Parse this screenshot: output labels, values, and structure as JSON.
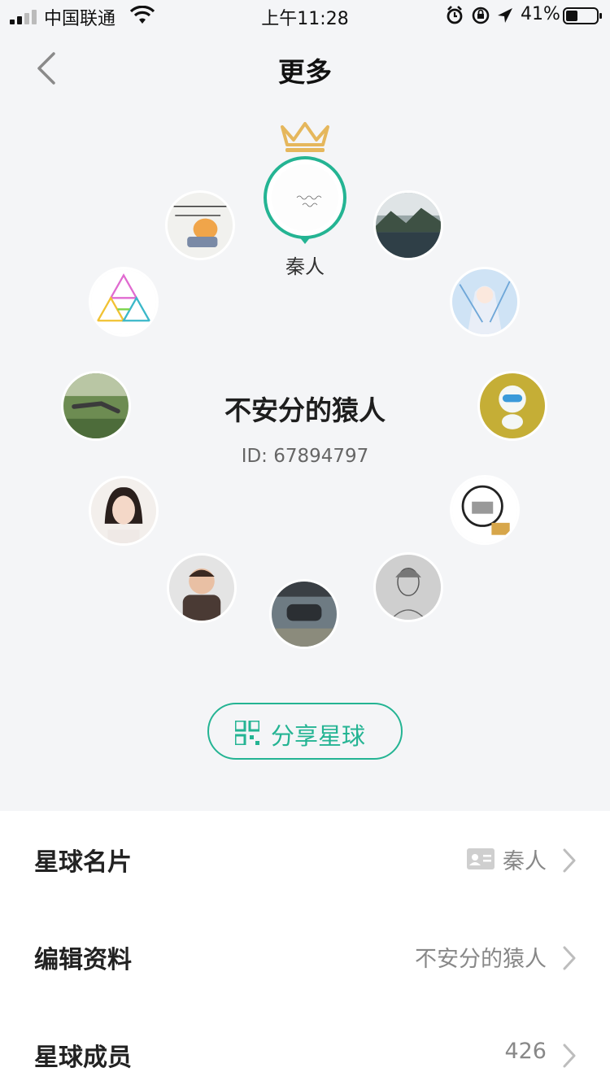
{
  "status_bar": {
    "carrier": "中国联通",
    "time": "上午11:28",
    "battery_pct": "41%",
    "icons": [
      "signal-icon",
      "wifi-icon",
      "alarm-icon",
      "rotation-lock-icon",
      "location-icon",
      "battery-icon"
    ]
  },
  "nav": {
    "title": "更多",
    "back_icon": "chevron-left-icon"
  },
  "planet": {
    "owner_name": "秦人",
    "name": "不安分的猿人",
    "id": "ID: 67894797",
    "owner_avatar_handwriting": "When they die / 都是秦人",
    "member_avatars": [
      "meme-cat",
      "lake-landscape",
      "anime-girl",
      "cartoon-dog",
      "meme-face",
      "sketch-portrait",
      "lying-man",
      "child",
      "woman",
      "yoga-outdoor",
      "triangle-fractal"
    ]
  },
  "share_button": {
    "label": "分享星球",
    "icon": "qr-code-icon"
  },
  "list": {
    "items": [
      {
        "label": "星球名片",
        "value": "秦人",
        "icon": "id-card-icon"
      },
      {
        "label": "编辑资料",
        "value": "不安分的猿人"
      },
      {
        "label": "星球成员",
        "value": "426"
      }
    ]
  },
  "colors": {
    "accent": "#24b493",
    "crown": "#e5b75c",
    "background": "#f4f5f7"
  }
}
